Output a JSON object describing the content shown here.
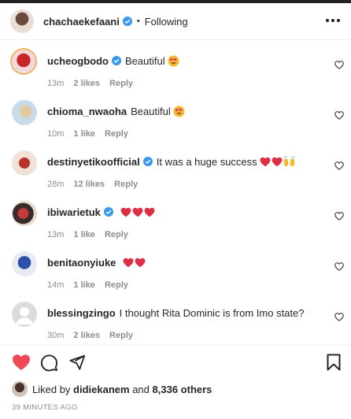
{
  "post": {
    "author": "chachaekefaani",
    "separator": "•",
    "follow_status": "Following"
  },
  "comments": [
    {
      "username": "ucheogbodo",
      "verified": true,
      "text": "Beautiful",
      "emoji": [
        "smiling-face-heart-eyes"
      ],
      "time": "13m",
      "likes": "2 likes",
      "reply": "Reply"
    },
    {
      "username": "chioma_nwaoha",
      "verified": false,
      "text": "Beautiful",
      "emoji": [
        "smiling-face-heart-eyes"
      ],
      "time": "10m",
      "likes": "1 like",
      "reply": "Reply"
    },
    {
      "username": "destinyetikoofficial",
      "verified": true,
      "text": "It was a huge success",
      "emoji": [
        "red-heart",
        "red-heart",
        "raising-hands"
      ],
      "time": "28m",
      "likes": "12 likes",
      "reply": "Reply"
    },
    {
      "username": "ibiwarietuk",
      "verified": true,
      "text": "",
      "emoji": [
        "red-heart",
        "red-heart",
        "red-heart"
      ],
      "time": "13m",
      "likes": "1 like",
      "reply": "Reply"
    },
    {
      "username": "benitaonyiuke",
      "verified": false,
      "text": "",
      "emoji": [
        "red-heart",
        "red-heart"
      ],
      "time": "14m",
      "likes": "1 like",
      "reply": "Reply"
    },
    {
      "username": "blessingzingo",
      "verified": false,
      "text": "I thought Rita Dominic is from Imo state?",
      "emoji": [],
      "time": "30m",
      "likes": "2 likes",
      "reply": "Reply"
    }
  ],
  "actions": {
    "like_icon": "heart-filled-icon",
    "comment_icon": "comment-icon",
    "share_icon": "paper-plane-icon",
    "save_icon": "bookmark-icon",
    "like_color": "#ed4956"
  },
  "liked_by": {
    "prefix": "Liked by",
    "user": "didiekanem",
    "conjunction": "and",
    "others": "8,336 others"
  },
  "time_ago": "39 MINUTES AGO",
  "colors": {
    "verified": "#3897f0",
    "muted": "#8e8e8e",
    "text": "#262626",
    "heart": "#ed4956"
  }
}
